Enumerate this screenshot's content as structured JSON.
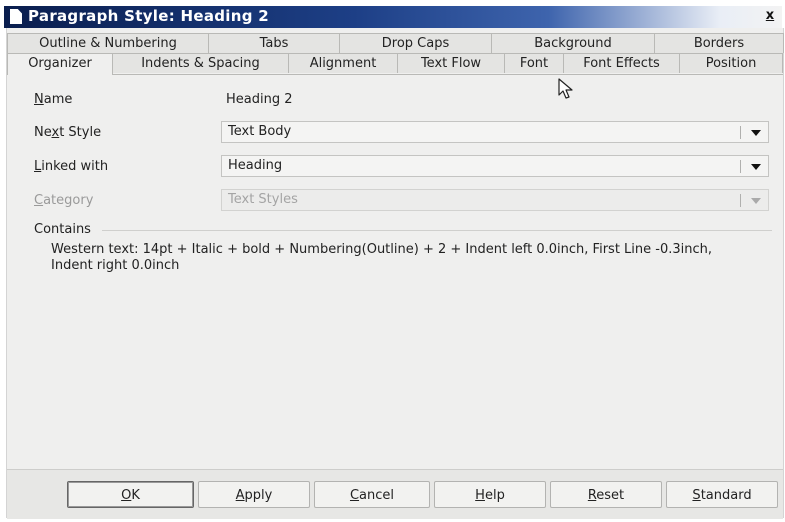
{
  "window": {
    "title": "Paragraph Style: Heading 2",
    "close_label": "x"
  },
  "tabs": {
    "row1": [
      "Outline & Numbering",
      "Tabs",
      "Drop Caps",
      "Background",
      "Borders"
    ],
    "row2": [
      "Organizer",
      "Indents & Spacing",
      "Alignment",
      "Text Flow",
      "Font",
      "Font Effects",
      "Position"
    ],
    "active": "Organizer"
  },
  "organizer": {
    "name": {
      "label_mnemonic": "N",
      "label_rest": "ame",
      "value": "Heading 2"
    },
    "next_style": {
      "label_pre": "Ne",
      "label_mnemonic": "x",
      "label_rest": "t Style",
      "value": "Text Body"
    },
    "linked_with": {
      "label_mnemonic": "L",
      "label_rest": "inked with",
      "value": "Heading"
    },
    "category": {
      "label_mnemonic": "C",
      "label_rest": "ategory",
      "value": "Text Styles",
      "disabled": true
    },
    "contains_label": "Contains",
    "contains_text": "Western text: 14pt + Italic + bold + Numbering(Outline) + 2 + Indent left 0.0inch, First Line -0.3inch, Indent right 0.0inch"
  },
  "buttons": {
    "ok": {
      "mnemonic": "O",
      "rest": "K"
    },
    "apply": {
      "mnemonic": "A",
      "rest": "pply"
    },
    "cancel": {
      "mnemonic": "C",
      "rest": "ancel"
    },
    "help": {
      "mnemonic": "H",
      "rest": "elp"
    },
    "reset": {
      "mnemonic": "R",
      "rest": "eset"
    },
    "standard": {
      "mnemonic": "S",
      "rest": "tandard"
    }
  },
  "icons": {
    "title_icon": "document-icon",
    "dropdown_icon": "chevron-down-icon",
    "cursor_icon": "mouse-pointer-icon"
  },
  "colors": {
    "titlebar_start": "#0a1e4e",
    "titlebar_mid": "#3e64ad",
    "dialog_bg": "#efefee"
  }
}
